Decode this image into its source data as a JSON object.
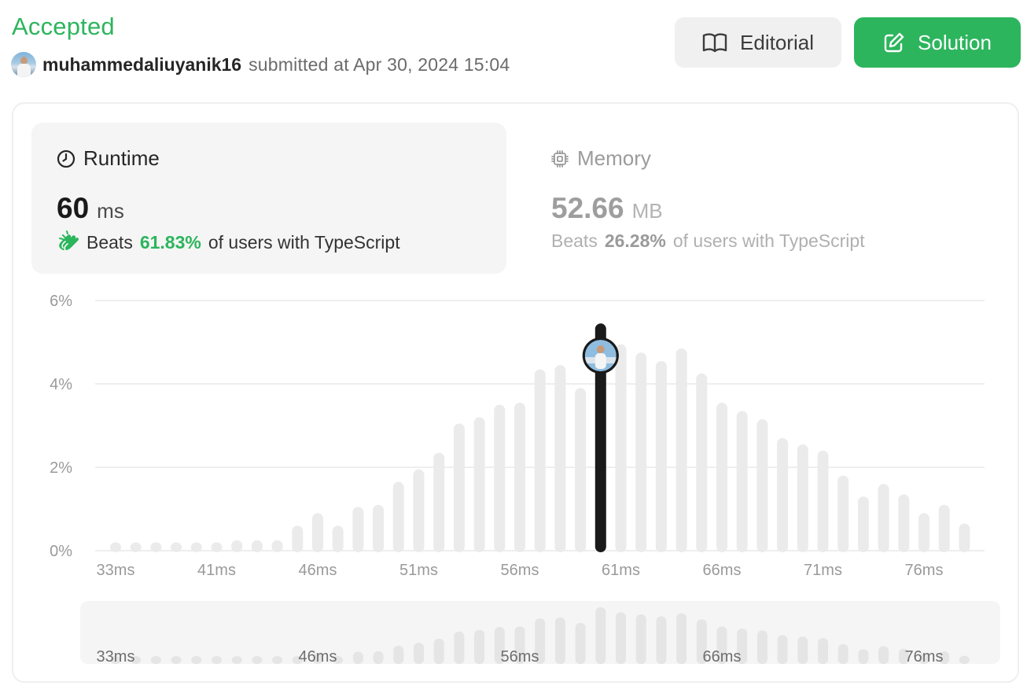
{
  "header": {
    "status": "Accepted",
    "username": "muhammedaliuyanik16",
    "submitted_text": "submitted at Apr 30, 2024 15:04",
    "editorial_label": "Editorial",
    "solution_label": "Solution"
  },
  "runtime": {
    "title": "Runtime",
    "value": "60",
    "unit": "ms",
    "beats_label": "Beats",
    "beats_pct": "61.83%",
    "beats_suffix": "of users with TypeScript"
  },
  "memory": {
    "title": "Memory",
    "value": "52.66",
    "unit": "MB",
    "beats_label": "Beats",
    "beats_pct": "26.28%",
    "beats_suffix": "of users with TypeScript"
  },
  "colors": {
    "accepted": "#2db55d",
    "solution_button": "#2cb55d",
    "bar": "#ebebeb",
    "selected_bar": "#1a1a1a"
  },
  "icons": {
    "editorial": "book-icon",
    "solution": "edit-icon",
    "runtime": "clock-icon",
    "memory": "chip-icon",
    "beats": "clapping-hands-icon"
  },
  "chart_data": {
    "type": "bar",
    "ylabel": "",
    "xlabel": "",
    "ylim": [
      0,
      6
    ],
    "yticks": [
      "6%",
      "4%",
      "2%",
      "0%"
    ],
    "grid": true,
    "xtick_labels": [
      "33ms",
      "41ms",
      "46ms",
      "51ms",
      "56ms",
      "61ms",
      "66ms",
      "71ms",
      "76ms"
    ],
    "values": [
      0.2,
      0.2,
      0.2,
      0.2,
      0.2,
      0.2,
      0.25,
      0.25,
      0.25,
      0.6,
      0.9,
      0.6,
      1.05,
      1.1,
      1.65,
      1.95,
      2.35,
      3.05,
      3.2,
      3.5,
      3.55,
      4.35,
      4.45,
      3.9,
      5.45,
      4.95,
      4.75,
      4.55,
      4.85,
      4.25,
      3.55,
      3.35,
      3.15,
      2.7,
      2.55,
      2.4,
      1.8,
      1.3,
      1.6,
      1.35,
      0.9,
      1.1,
      0.65
    ],
    "selected_index": 24,
    "selected_label": "60ms",
    "overview_tick_labels": [
      "33ms",
      "46ms",
      "56ms",
      "66ms",
      "76ms"
    ]
  }
}
